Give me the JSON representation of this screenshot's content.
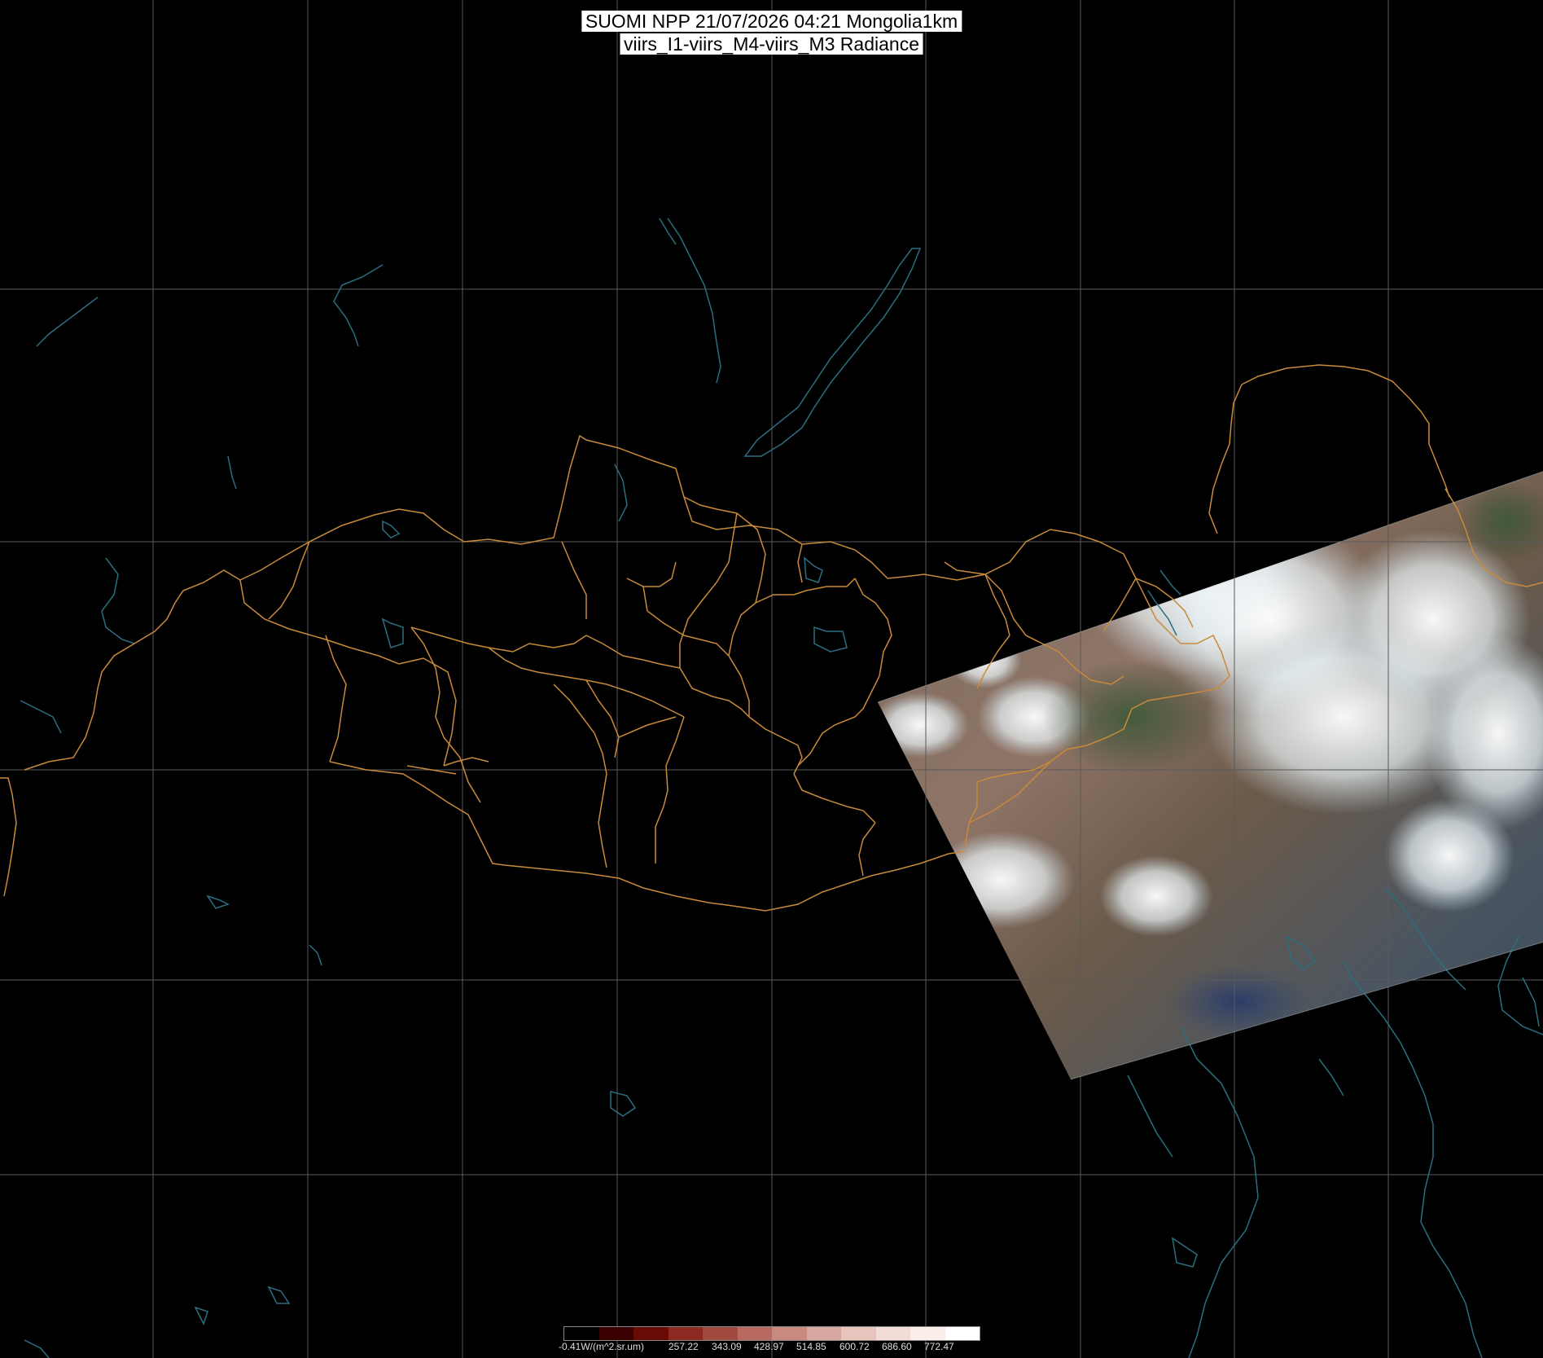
{
  "title": {
    "line1": "SUOMI NPP 21/07/2026 04:21 Mongolia1km",
    "line2": "viirs_I1-viirs_M4-viirs_M3 Radiance"
  },
  "colorbar": {
    "unit_label": "-0.41W/(m^2.sr.um)",
    "ticks": [
      "257.22",
      "343.09",
      "428.97",
      "514.85",
      "600.72",
      "686.60",
      "772.47"
    ],
    "colors": [
      "#000000",
      "#3a0000",
      "#6a0a05",
      "#8a2a20",
      "#a04a40",
      "#b86a60",
      "#c88a80",
      "#d8a8a0",
      "#e8c4bc",
      "#f2dcd6",
      "#faeeea",
      "#ffffff"
    ]
  },
  "map": {
    "background": "#000000",
    "grid_color": "#5a5a5a",
    "border_color": "#c98a3a",
    "water_color": "#2a6f80"
  }
}
